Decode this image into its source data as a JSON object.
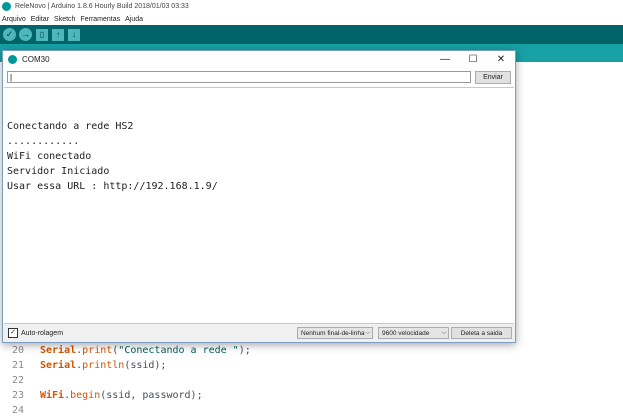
{
  "ide": {
    "title": "ReleNovo | Arduino 1.8.6 Hourly Build 2018/01/03 03:33",
    "menu": [
      "Arquivo",
      "Editar",
      "Sketch",
      "Ferramentas",
      "Ajuda"
    ],
    "toolbar_icons": [
      "verify-icon",
      "upload-icon",
      "new-icon",
      "open-icon",
      "save-icon"
    ]
  },
  "serial_monitor": {
    "title": "COM30",
    "input_value": "|",
    "send_label": "Enviar",
    "output_lines": [
      "",
      "",
      "Conectando a rede HS2",
      "............",
      "WiFi conectado",
      "Servidor Iniciado",
      "Usar essa URL : http://192.168.1.9/"
    ],
    "autoscroll_label": "Auto-rolagem",
    "autoscroll_checked": true,
    "line_ending": "Nenhum final-de-linha",
    "baud_rate": "9600 velocidade",
    "clear_label": "Deleta a saida"
  },
  "editor": {
    "lines": [
      {
        "num": "20",
        "obj": "Serial",
        "fn": "print",
        "arg": "\"Conectando a rede \"",
        "rest": ");"
      },
      {
        "num": "21",
        "obj": "Serial",
        "fn": "println",
        "arg": "",
        "rest": "(ssid);"
      },
      {
        "num": "22",
        "obj": "",
        "fn": "",
        "arg": "",
        "rest": ""
      },
      {
        "num": "23",
        "obj": "WiFi",
        "fn": "begin",
        "arg": "",
        "rest": "(ssid, password);"
      },
      {
        "num": "24",
        "obj": "",
        "fn": "",
        "arg": "",
        "rest": ""
      }
    ]
  },
  "colors": {
    "toolbar": "#006468",
    "tabstrip": "#17a1a5",
    "keyword": "#d35400",
    "string": "#005c5f"
  }
}
